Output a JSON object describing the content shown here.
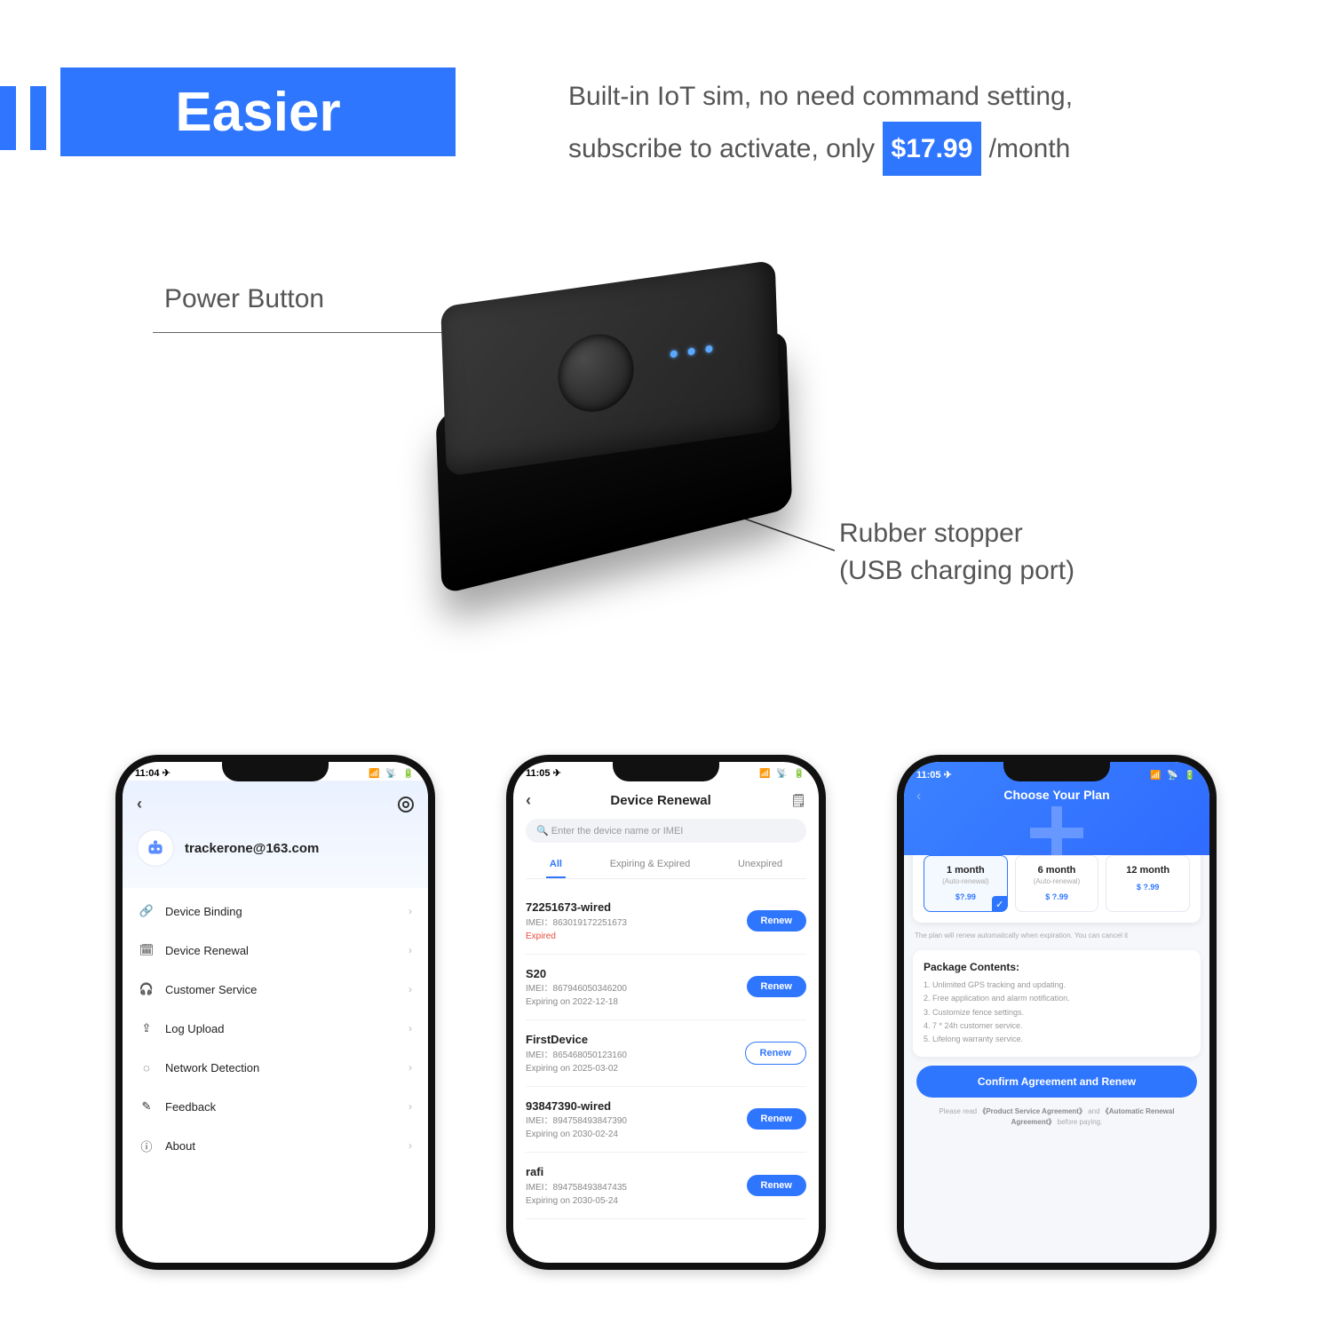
{
  "header": {
    "badge": "Easier",
    "line1": "Built-in IoT sim, no need command setting,",
    "line2a": "subscribe to activate, only ",
    "price": "$17.99",
    "line2b": "/month"
  },
  "device": {
    "label_power": "Power Button",
    "label_usb_line1": "Rubber stopper",
    "label_usb_line2": "(USB charging port)"
  },
  "phone1": {
    "time": "11:04 ✈",
    "email": "trackerone@163.com",
    "menu": [
      "Device Binding",
      "Device Renewal",
      "Customer Service",
      "Log Upload",
      "Network Detection",
      "Feedback",
      "About"
    ]
  },
  "phone2": {
    "time": "11:05 ✈",
    "title": "Device Renewal",
    "search_placeholder": "Enter the device name or IMEI",
    "tabs": [
      "All",
      "Expiring & Expired",
      "Unexpired"
    ],
    "renew": "Renew",
    "devices": [
      {
        "name": "72251673-wired",
        "imei": "IMEI：863019172251673",
        "status": "Expired",
        "expired": true,
        "outline": false
      },
      {
        "name": "S20",
        "imei": "IMEI：867946050346200",
        "status": "Expiring on 2022-12-18",
        "expired": false,
        "outline": false
      },
      {
        "name": "FirstDevice",
        "imei": "IMEI：865468050123160",
        "status": "Expiring on 2025-03-02",
        "expired": false,
        "outline": true
      },
      {
        "name": "93847390-wired",
        "imei": "IMEI：894758493847390",
        "status": "Expiring on 2030-02-24",
        "expired": false,
        "outline": false
      },
      {
        "name": "rafi",
        "imei": "IMEI：894758493847435",
        "status": "Expiring on 2030-05-24",
        "expired": false,
        "outline": false
      }
    ]
  },
  "phone3": {
    "time": "11:05 ✈",
    "title": "Choose Your Plan",
    "card_title": "Choose your plan",
    "currency": "$ ▾",
    "plans": [
      {
        "name": "1 month",
        "sub": "(Auto-renewal)",
        "price": "?.99",
        "selected": true
      },
      {
        "name": "6 month",
        "sub": "(Auto-renewal)",
        "price": "?.99",
        "selected": false
      },
      {
        "name": "12 month",
        "sub": "",
        "price": "?.99",
        "selected": false
      }
    ],
    "auto_note": "The plan will renew automatically when expiration. You can cancel it",
    "pkg_title": "Package Contents:",
    "pkg": [
      "1. Unlimited GPS tracking and updating.",
      "2. Free application and alarm notification.",
      "3. Customize fence settings.",
      "4. 7 * 24h customer service.",
      "5. Lifelong warranty service."
    ],
    "confirm": "Confirm Agreement and Renew",
    "disclaimer_a": "Please read ",
    "disclaimer_b": "《Product Service Agreement》",
    "disclaimer_c": " and ",
    "disclaimer_d": "《Automatic Renewal Agreement》",
    "disclaimer_e": " before paying."
  }
}
